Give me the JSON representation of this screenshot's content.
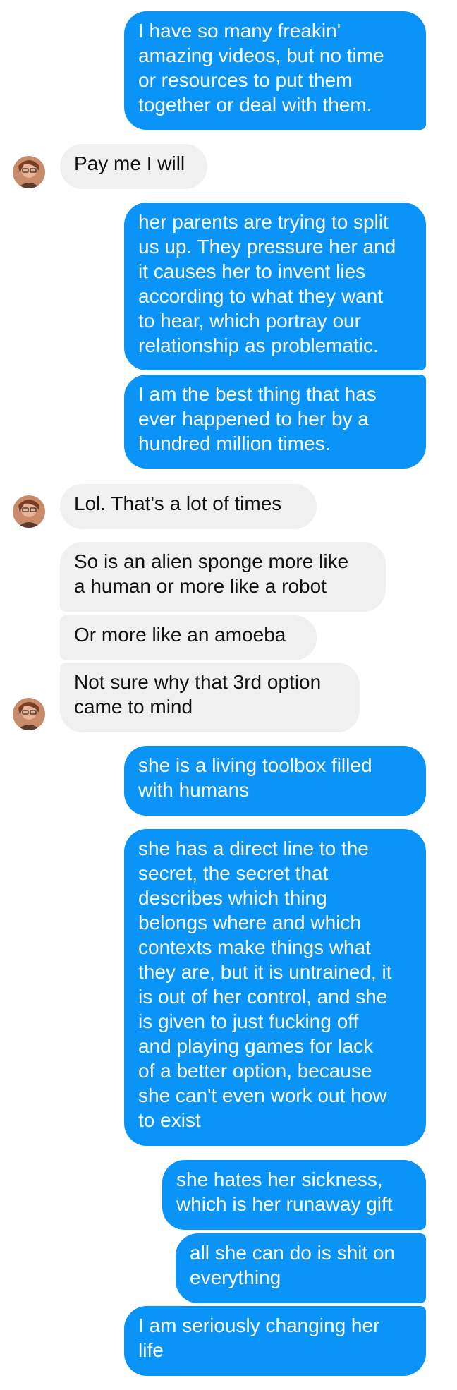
{
  "messages": [
    {
      "side": "out",
      "text": "I have so many freakin'\namazing videos, but no time\nor resources to put them\ntogether or deal with them."
    },
    {
      "side": "in",
      "text": "Pay me I will"
    },
    {
      "side": "out",
      "text": "her parents are trying to split\nus up. They pressure her and\nit causes her to invent lies\naccording to what they want\nto hear, which portray our\nrelationship as problematic."
    },
    {
      "side": "out",
      "text": "I am the best thing that has\never happened to her by a\nhundred million times."
    },
    {
      "side": "in",
      "text": "Lol. That's a lot of times"
    },
    {
      "side": "in",
      "text": "So is an alien sponge more like\na human or more like a robot"
    },
    {
      "side": "in",
      "text": "Or more like an amoeba"
    },
    {
      "side": "in",
      "text": "Not sure why that 3rd option\ncame to mind"
    },
    {
      "side": "out",
      "text": "she is a living toolbox filled\nwith humans"
    },
    {
      "side": "out",
      "text": "she has a direct line to the\nsecret, the secret that\ndescribes which thing\nbelongs where and which\ncontexts make things what\nthey are, but it is untrained, it\nis out of her control, and she\nis given to just fucking off\nand playing games for lack\nof a better option, because\nshe can't even work out how\nto exist"
    },
    {
      "side": "out",
      "text": "she hates her sickness,\nwhich is her runaway gift"
    },
    {
      "side": "out",
      "text": "all she can do is shit on\neverything"
    },
    {
      "side": "out",
      "text": "I am seriously changing her\nlife"
    }
  ],
  "colors": {
    "outgoing_bubble": "#0a94f8",
    "incoming_bubble": "#f1f0f0",
    "outgoing_text": "#ffffff",
    "incoming_text": "#111111"
  },
  "avatar_icon": "contact-avatar-icon"
}
